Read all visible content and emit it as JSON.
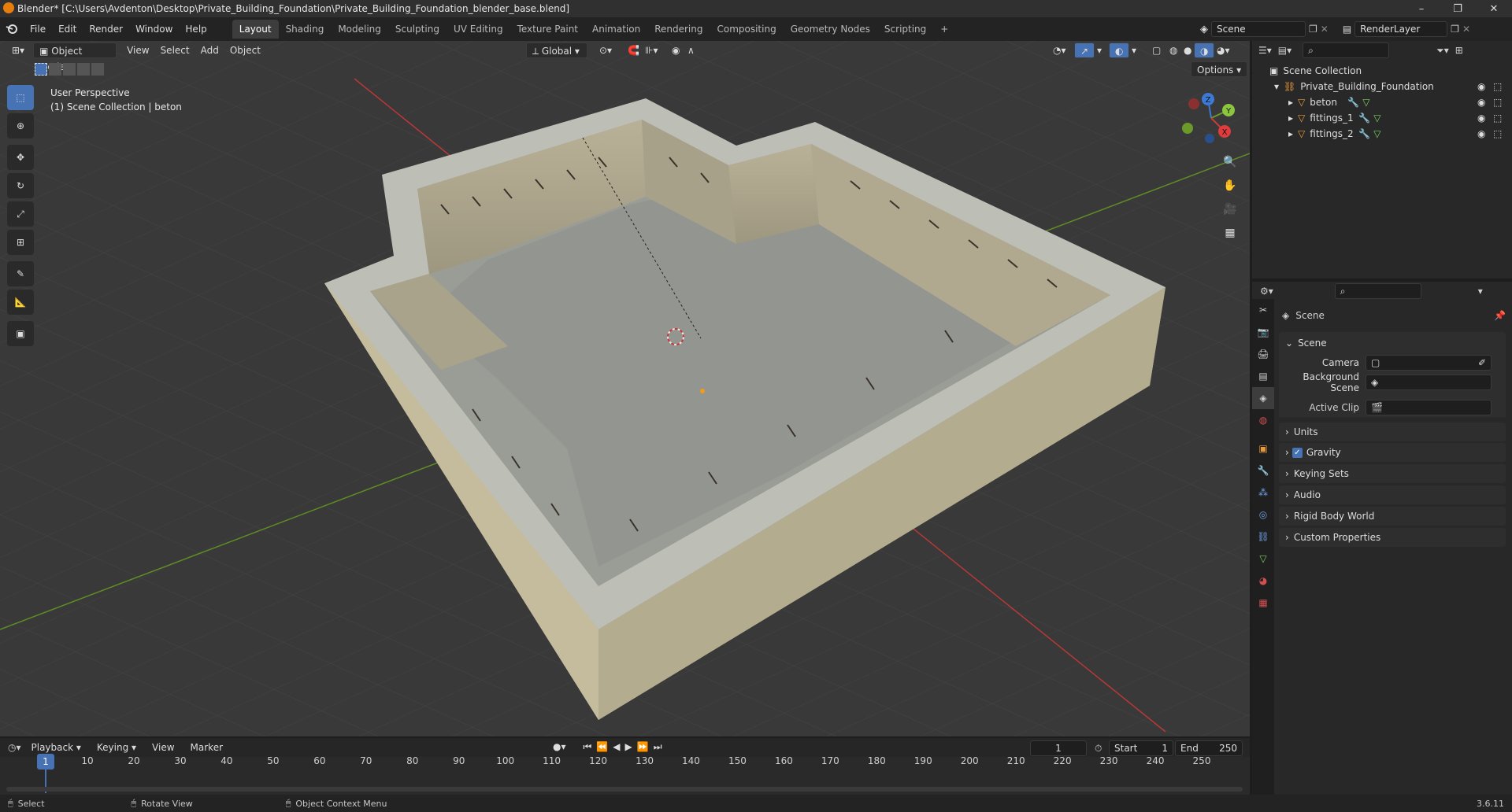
{
  "titlebar": {
    "title": "Blender* [C:\\Users\\Avdenton\\Desktop\\Private_Building_Foundation\\Private_Building_Foundation_blender_base.blend]",
    "minimize": "–",
    "maximize": "❐",
    "close": "✕"
  },
  "menus": [
    "File",
    "Edit",
    "Render",
    "Window",
    "Help"
  ],
  "workspaces": [
    "Layout",
    "Shading",
    "Modeling",
    "Sculpting",
    "UV Editing",
    "Texture Paint",
    "Animation",
    "Rendering",
    "Compositing",
    "Geometry Nodes",
    "Scripting"
  ],
  "add_workspace": "+",
  "scene_selector": {
    "value": "Scene"
  },
  "view_layer_selector": {
    "value": "RenderLayer"
  },
  "viewport_header": {
    "mode": "Object Mode",
    "menus": [
      "View",
      "Select",
      "Add",
      "Object"
    ],
    "orientation": "Global",
    "options": "Options"
  },
  "viewport_overlay": {
    "line1": "User Perspective",
    "line2": "(1) Scene Collection | beton"
  },
  "gizmo": {
    "z": "Z",
    "y": "Y",
    "x": "X"
  },
  "outliner": {
    "root": "Scene Collection",
    "collection": "Private_Building_Foundation",
    "items": [
      "beton",
      "fittings_1",
      "fittings_2"
    ]
  },
  "properties": {
    "context": "Scene",
    "scene_panel": "Scene",
    "camera_label": "Camera",
    "background_scene_label": "Background Scene",
    "active_clip_label": "Active Clip",
    "panels": [
      "Units",
      "Gravity",
      "Keying Sets",
      "Audio",
      "Rigid Body World",
      "Custom Properties"
    ]
  },
  "timeline": {
    "menus": [
      "Playback",
      "Keying",
      "View",
      "Marker"
    ],
    "current_frame": "1",
    "start_label": "Start",
    "start_value": "1",
    "end_label": "End",
    "end_value": "250",
    "ticks": [
      "1",
      "10",
      "20",
      "30",
      "40",
      "50",
      "60",
      "70",
      "80",
      "90",
      "100",
      "110",
      "120",
      "130",
      "140",
      "150",
      "160",
      "170",
      "180",
      "190",
      "200",
      "210",
      "220",
      "230",
      "240",
      "250"
    ]
  },
  "statusbar": {
    "select": "Select",
    "rotate": "Rotate View",
    "context_menu": "Object Context Menu",
    "version": "3.6.11"
  },
  "colors": {
    "accent": "#4772b3",
    "x_axis": "#c43c3c",
    "y_axis": "#6b9a2a",
    "z_axis": "#3c7ad6",
    "viewport_bg": "#3a3a3a"
  }
}
